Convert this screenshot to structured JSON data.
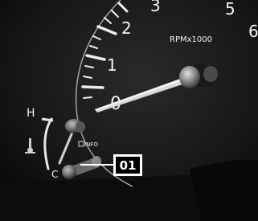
{
  "tachometer": {
    "unit_label": "RPMx1000",
    "scale_numbers": [
      "0",
      "1",
      "2",
      "3",
      "5",
      "6"
    ]
  },
  "temperature_gauge": {
    "high_label": "H"
  },
  "info_label": "INFO",
  "callout": {
    "label": "01"
  }
}
